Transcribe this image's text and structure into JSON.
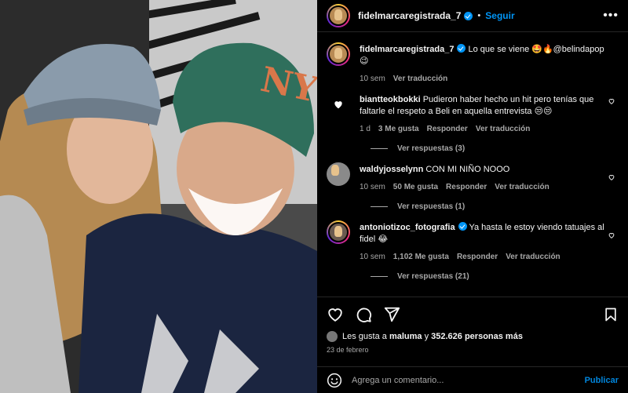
{
  "post": {
    "author": "fidelmarcaregistrada_7",
    "follow_label": "Seguir",
    "more_label": "•••",
    "separator": "•"
  },
  "caption": {
    "username": "fidelmarcaregistrada_7",
    "text": "Lo que se viene 🤩🔥@belindapop 😉",
    "time": "10 sem",
    "translate": "Ver traducción"
  },
  "comments": [
    {
      "username": "biantteokbokki",
      "text": "Pudieron haber hecho un hit pero tenías que faltarle el respeto a Beli en aquella entrevista 😒😒",
      "time": "1 d",
      "likes": "3 Me gusta",
      "reply": "Responder",
      "translate": "Ver traducción",
      "replies": "Ver respuestas (3)"
    },
    {
      "username": "waldyjosselynn",
      "text": "CON MI NIÑO NOOO",
      "time": "10 sem",
      "likes": "50 Me gusta",
      "reply": "Responder",
      "translate": "Ver traducción",
      "replies": "Ver respuestas (1)"
    },
    {
      "username": "antoniotizoc_fotografia",
      "text": "Ya hasta le estoy viendo tatuajes al fidel 😂",
      "time": "10 sem",
      "likes": "1,102 Me gusta",
      "reply": "Responder",
      "translate": "Ver traducción",
      "replies": "Ver respuestas (21)"
    }
  ],
  "likes_summary": {
    "prefix": "Les gusta a",
    "user": "maluma",
    "middle": "y",
    "count": "352.626 personas más"
  },
  "date": "23 de febrero",
  "composer": {
    "placeholder": "Agrega un comentario...",
    "publish_label": "Publicar"
  },
  "icons": [
    "heart-icon",
    "comment-icon",
    "share-icon",
    "bookmark-icon",
    "emoji-icon",
    "more-icon",
    "verified-icon"
  ],
  "colors": {
    "accent": "#0095f6",
    "background": "#000000",
    "muted": "#a8a8a8",
    "text": "#f5f5f5"
  }
}
